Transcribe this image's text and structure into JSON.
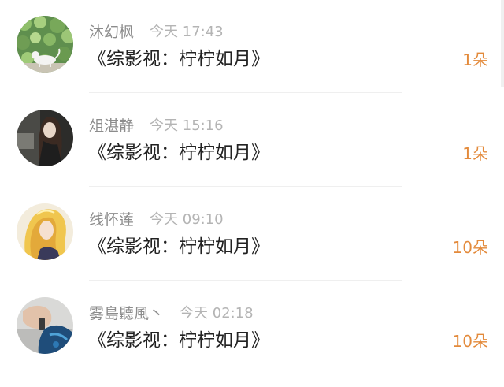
{
  "rows": [
    {
      "name": "沐幻枫",
      "time": "今天 17:43",
      "title": "《综影视：柠柠如月》",
      "count": "1朵",
      "avatar": "cat-on-green-foliage"
    },
    {
      "name": "俎湛静",
      "time": "今天 15:16",
      "title": "《综影视：柠柠如月》",
      "count": "1朵",
      "avatar": "dark-haired-woman-portrait"
    },
    {
      "name": "线怀莲",
      "time": "今天 09:10",
      "title": "《综影视：柠柠如月》",
      "count": "10朵",
      "avatar": "blonde-anime-character"
    },
    {
      "name": "雾島聽風丶",
      "time": "今天 02:18",
      "title": "《综影视：柠柠如月》",
      "count": "10朵",
      "avatar": "hand-holding-lighter-blue"
    }
  ],
  "colors": {
    "count": "#e38a3b",
    "name": "#8c8c8c",
    "time": "#b4b4b4",
    "title": "#222222"
  }
}
